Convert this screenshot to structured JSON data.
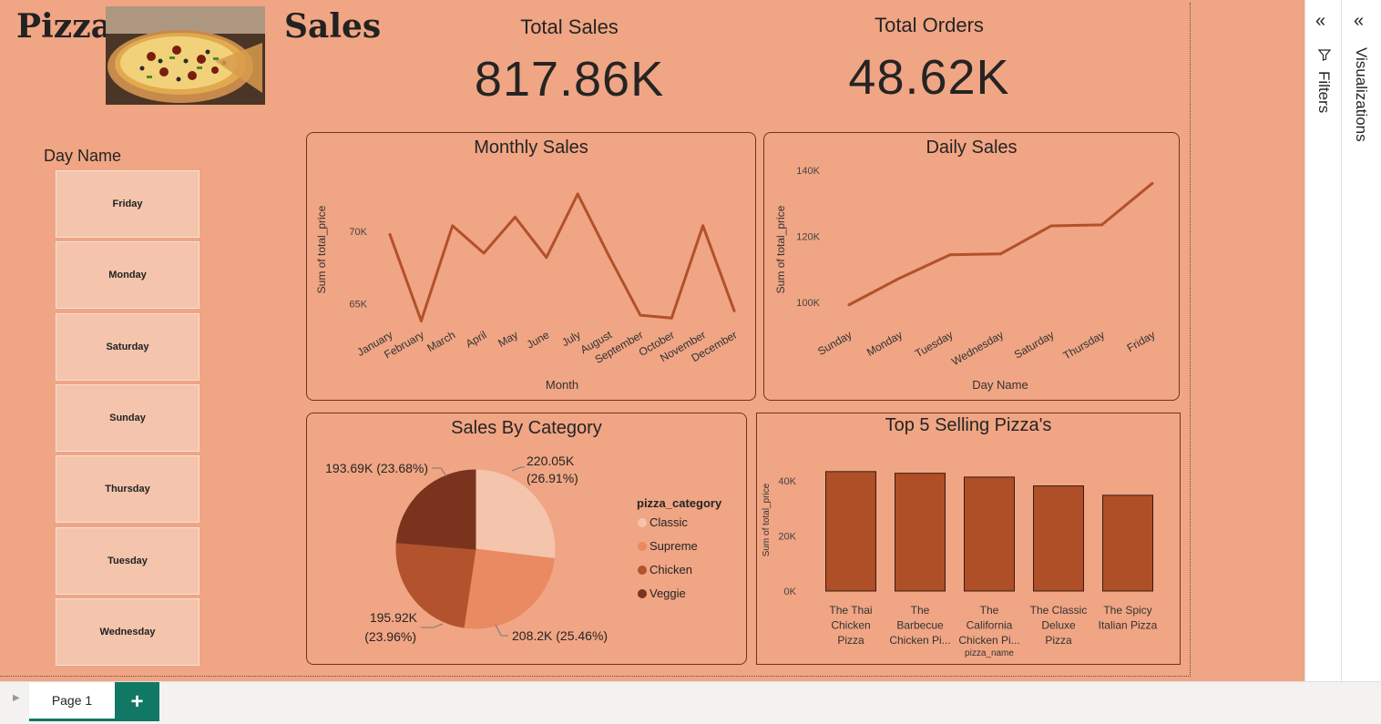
{
  "header": {
    "title_left": "Pizza",
    "title_right": "Sales"
  },
  "kpis": {
    "total_sales_label": "Total Sales",
    "total_sales_value": "817.86K",
    "total_orders_label": "Total Orders",
    "total_orders_value": "48.62K"
  },
  "slicer": {
    "title": "Day Name",
    "items": [
      "Friday",
      "Monday",
      "Saturday",
      "Sunday",
      "Thursday",
      "Tuesday",
      "Wednesday"
    ]
  },
  "monthly": {
    "title": "Monthly Sales"
  },
  "daily": {
    "title": "Daily Sales"
  },
  "category": {
    "title": "Sales By Category",
    "legend_title": "pizza_category",
    "legend": [
      "Classic",
      "Supreme",
      "Chicken",
      "Veggie"
    ]
  },
  "top5": {
    "title": "Top 5 Selling Pizza's"
  },
  "panes": {
    "filters": "Filters",
    "visualizations": "Visualizations"
  },
  "footer": {
    "page_tab": "Page 1",
    "add_page": "+"
  },
  "colors": {
    "canvas": "#F0A584",
    "line": "#B3502A",
    "classic": "#F4C4AC",
    "supreme": "#E98A62",
    "chicken": "#B3532D",
    "veggie": "#7A341E",
    "bar": "#AE4F28",
    "accent": "#117865"
  },
  "chart_data": [
    {
      "type": "line",
      "title": "Monthly Sales",
      "xlabel": "Month",
      "ylabel": "Sum of total_price",
      "categories": [
        "January",
        "February",
        "March",
        "April",
        "May",
        "June",
        "July",
        "August",
        "September",
        "October",
        "November",
        "December"
      ],
      "values": [
        69.8,
        63.8,
        70.4,
        68.5,
        71.0,
        68.2,
        72.6,
        68.3,
        64.2,
        64.0,
        70.4,
        64.5
      ],
      "yticks": [
        "65K",
        "70K"
      ],
      "ytick_values": [
        65,
        70
      ],
      "ylim": [
        62.5,
        75.0
      ],
      "grid": false
    },
    {
      "type": "line",
      "title": "Daily Sales",
      "xlabel": "Day Name",
      "ylabel": "Sum of total_price",
      "categories": [
        "Sunday",
        "Monday",
        "Tuesday",
        "Wednesday",
        "Saturday",
        "Thursday",
        "Friday"
      ],
      "values": [
        99.2,
        107.3,
        114.4,
        114.7,
        123.2,
        123.5,
        136.1
      ],
      "yticks": [
        "100K",
        "120K",
        "140K"
      ],
      "ytick_values": [
        100,
        120,
        140
      ],
      "ylim": [
        90,
        142
      ],
      "grid": false
    },
    {
      "type": "pie",
      "title": "Sales By Category",
      "legend_title": "pizza_category",
      "labels": [
        "Classic",
        "Supreme",
        "Chicken",
        "Veggie"
      ],
      "values": [
        220.05,
        208.2,
        195.92,
        193.69
      ],
      "percents": [
        26.91,
        25.46,
        23.96,
        23.68
      ],
      "data_labels": [
        "220.05K (26.91%)",
        "208.2K (25.46%)",
        "195.92K (23.96%)",
        "193.69K (23.68%)"
      ],
      "legend_position": "right"
    },
    {
      "type": "bar",
      "title": "Top 5 Selling Pizza's",
      "xlabel": "pizza_name",
      "ylabel": "Sum of total_price",
      "categories": [
        "The Thai Chicken Pizza",
        "The Barbecue Chicken Pizza",
        "The California Chicken Pizza",
        "The Classic Deluxe Pizza",
        "The Spicy Italian Pizza"
      ],
      "category_labels": [
        [
          "The Thai",
          "Chicken",
          "Pizza"
        ],
        [
          "The",
          "Barbecue",
          "Chicken Pi..."
        ],
        [
          "The",
          "California",
          "Chicken Pi..."
        ],
        [
          "The Classic",
          "Deluxe",
          "Pizza"
        ],
        [
          "The Spicy",
          "Italian Pizza"
        ]
      ],
      "values": [
        43.4,
        42.8,
        41.4,
        38.2,
        34.8
      ],
      "yticks": [
        "0K",
        "20K",
        "40K"
      ],
      "ytick_values": [
        0,
        20,
        40
      ],
      "ylim": [
        0,
        45
      ]
    }
  ]
}
